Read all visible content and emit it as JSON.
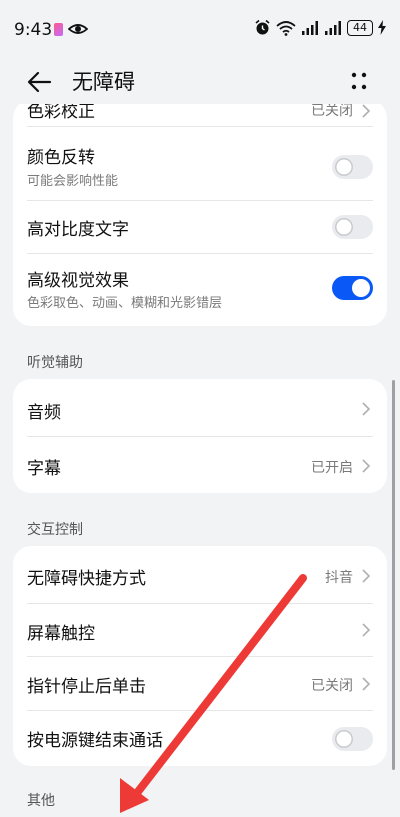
{
  "status_bar": {
    "time": "9:43",
    "battery": "44"
  },
  "header": {
    "title": "无障碍"
  },
  "card1": {
    "color_correction": {
      "label": "色彩校正",
      "value": "已关闭"
    },
    "color_inversion": {
      "label": "颜色反转",
      "sub": "可能会影响性能",
      "enabled": false
    },
    "high_contrast_text": {
      "label": "高对比度文字",
      "enabled": false
    },
    "advanced_visual_effects": {
      "label": "高级视觉效果",
      "sub": "色彩取色、动画、模糊和光影错层",
      "enabled": true
    }
  },
  "section_hearing": {
    "title": "听觉辅助"
  },
  "hearing": {
    "audio": {
      "label": "音频"
    },
    "captions": {
      "label": "字幕",
      "value": "已开启"
    }
  },
  "section_interaction": {
    "title": "交互控制"
  },
  "interaction": {
    "shortcut": {
      "label": "无障碍快捷方式",
      "value": "抖音"
    },
    "touch": {
      "label": "屏幕触控"
    },
    "dwell_click": {
      "label": "指针停止后单击",
      "value": "已关闭"
    },
    "power_end_call": {
      "label": "按电源键结束通话",
      "enabled": false
    }
  },
  "section_other": {
    "title": "其他"
  },
  "colors": {
    "accent": "#0a59f7",
    "annotation_arrow": "#ee3a36",
    "background": "#f1f3f5"
  }
}
